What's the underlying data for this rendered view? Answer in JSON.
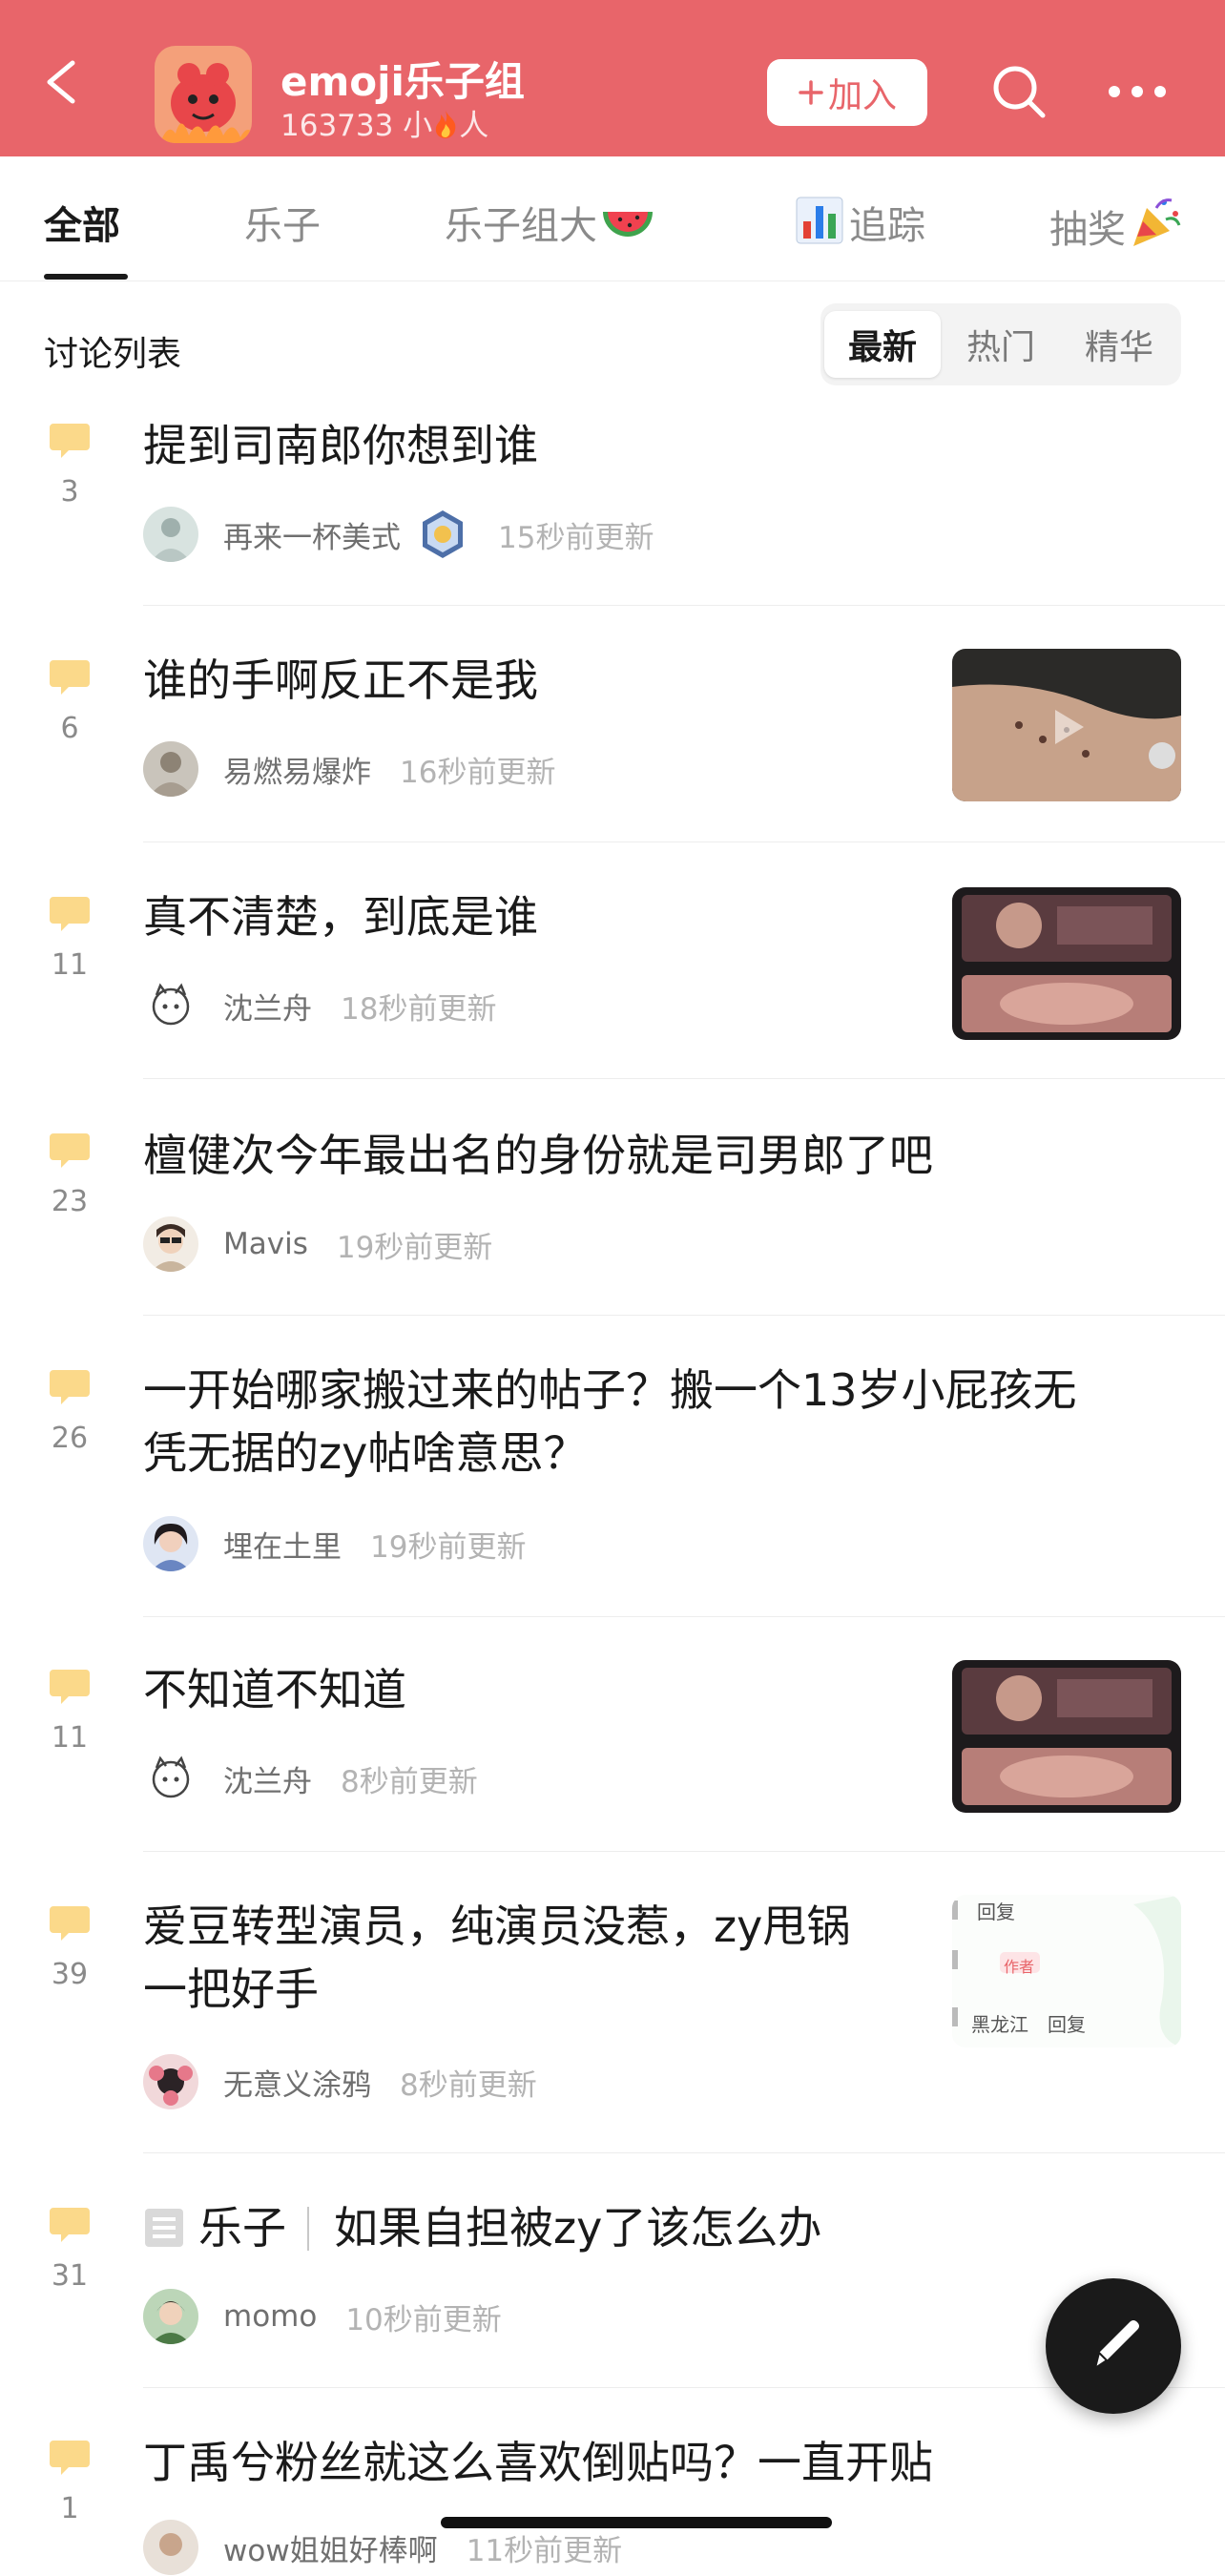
{
  "header": {
    "back_icon": "chevron-left-icon",
    "group_name": "emoji乐子组",
    "member_count": "163733",
    "member_label_pre": "小",
    "member_label_post": "人",
    "join_label": "加入",
    "search_icon": "search-icon",
    "more_icon": "more-icon",
    "bg_color": "#e8656a"
  },
  "tabs": [
    {
      "label": "全部",
      "active": true
    },
    {
      "label": "乐子",
      "active": false
    },
    {
      "label": "乐子组大",
      "icon": "watermelon-icon",
      "active": false
    },
    {
      "label": "追踪",
      "icon": "bar-chart-icon",
      "active": false
    },
    {
      "label": "抽奖",
      "icon": "party-popper-icon",
      "active": false
    }
  ],
  "list": {
    "title": "讨论列表",
    "sort_options": [
      {
        "label": "最新",
        "active": true
      },
      {
        "label": "热门",
        "active": false
      },
      {
        "label": "精华",
        "active": false
      }
    ]
  },
  "posts": [
    {
      "count": "3",
      "title": "提到司南郎你想到谁",
      "author": "再来一杯美式",
      "time": "15秒前更新",
      "badge": true
    },
    {
      "count": "6",
      "title": "谁的手啊反正不是我",
      "author": "易燃易爆炸",
      "time": "16秒前更新",
      "thumb": "hand-video"
    },
    {
      "count": "11",
      "title": "真不清楚，到底是谁",
      "author": "沈兰舟",
      "time": "18秒前更新",
      "thumb": "event-photo"
    },
    {
      "count": "23",
      "title": "檀健次今年最出名的身份就是司男郎了吧",
      "author": "Mavis",
      "time": "19秒前更新"
    },
    {
      "count": "26",
      "title_line1": "一开始哪家搬过来的帖子？搬一个13岁小屁孩无",
      "title_line2": "凭无据的zy帖啥意思？",
      "author": "埋在土里",
      "time": "19秒前更新"
    },
    {
      "count": "11",
      "title": "不知道不知道",
      "author": "沈兰舟",
      "time": "8秒前更新",
      "thumb": "event-photo"
    },
    {
      "count": "39",
      "title_line1": "爱豆转型演员，纯演员没惹，zy甩锅",
      "title_line2": "一把好手",
      "author": "无意义涂鸦",
      "time": "8秒前更新",
      "thumb_text": [
        "回复",
        "作者",
        "黑龙江",
        "回复"
      ]
    },
    {
      "count": "31",
      "category": "乐子",
      "title": "如果自担被zy了该怎么办",
      "author": "momo",
      "time": "10秒前更新"
    },
    {
      "count": "1",
      "title": "丁禹兮粉丝就这么喜欢倒贴吗？一直开贴",
      "author": "wow姐姐好棒啊",
      "time": "11秒前更新"
    }
  ]
}
